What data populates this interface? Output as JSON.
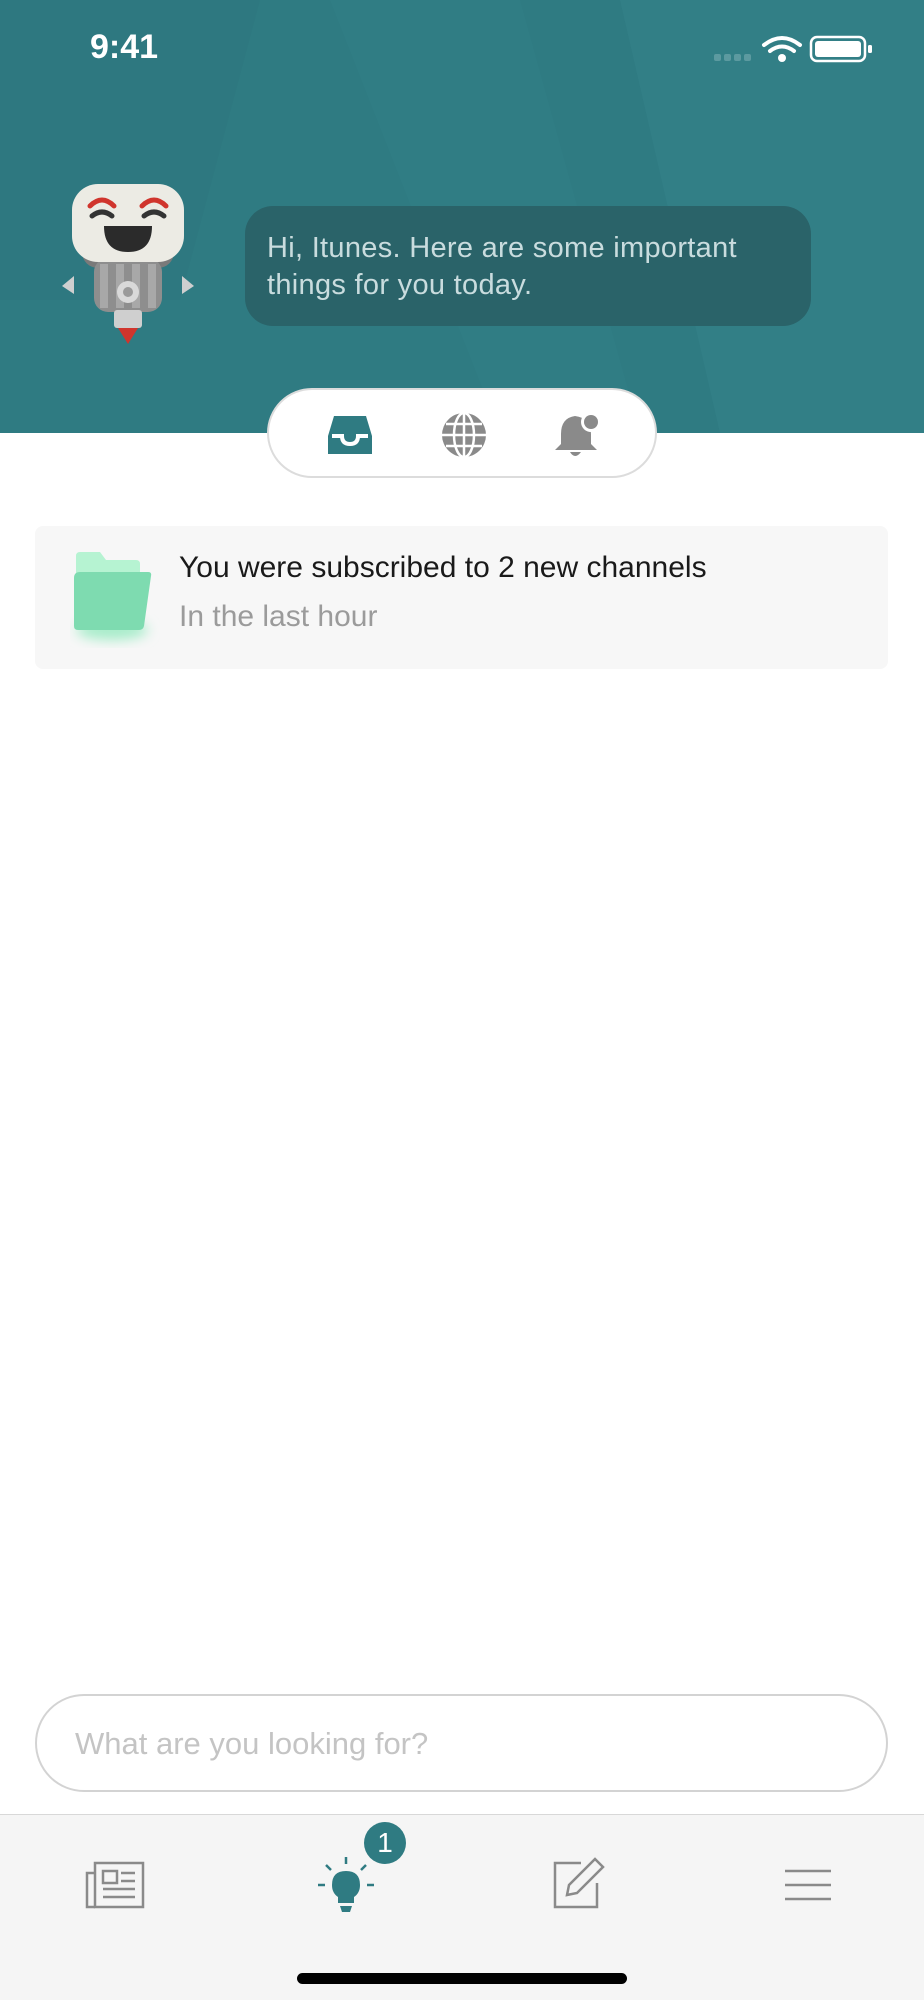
{
  "status_bar": {
    "time": "9:41"
  },
  "header": {
    "greeting": "Hi, Itunes. Here are some important things for you today."
  },
  "segments": [
    {
      "icon": "inbox-icon",
      "active": true
    },
    {
      "icon": "globe-icon",
      "active": false
    },
    {
      "icon": "bell-notification-icon",
      "active": false
    }
  ],
  "notification": {
    "icon": "folder-icon",
    "title": "You were subscribed to 2 new channels",
    "subtitle": "In the last hour"
  },
  "search": {
    "placeholder": "What are you looking for?"
  },
  "tabbar": {
    "tabs": [
      {
        "icon": "newspaper-icon"
      },
      {
        "icon": "lightbulb-icon",
        "active": true
      },
      {
        "icon": "edit-icon"
      },
      {
        "icon": "menu-icon"
      }
    ],
    "badge": "1"
  },
  "colors": {
    "accent": "#2f7b82",
    "bubble": "#2a6369",
    "folder": "#7edbb0"
  }
}
